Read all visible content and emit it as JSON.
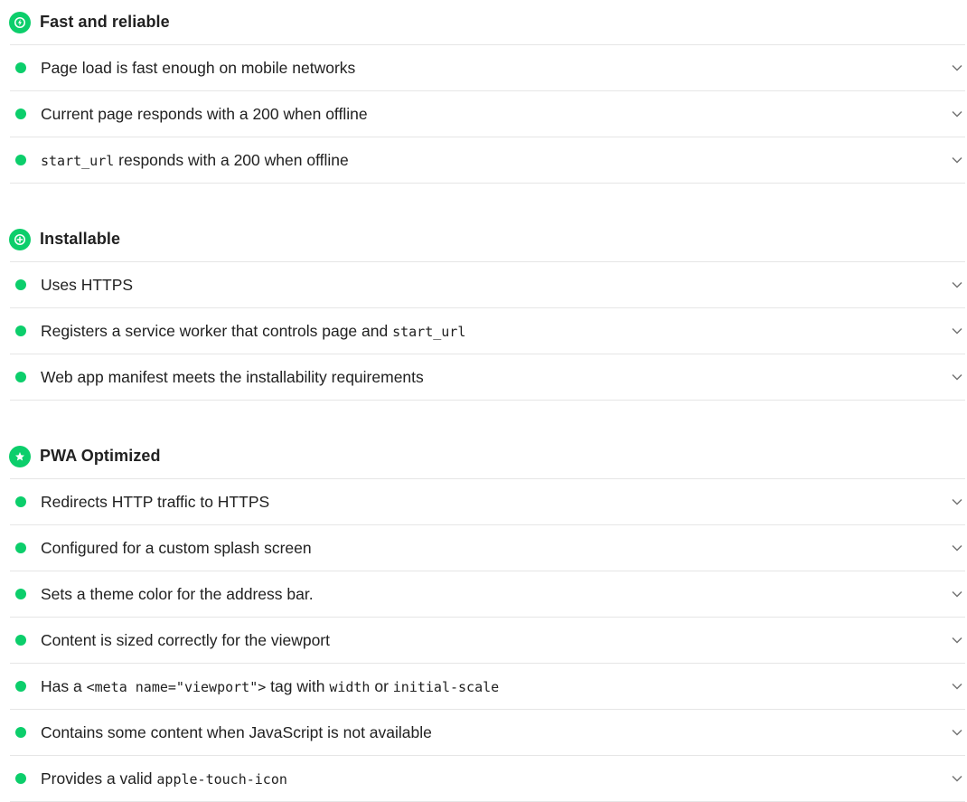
{
  "groups": [
    {
      "title": "Fast and reliable",
      "icon": "lightning-bolt-icon",
      "audits": [
        {
          "parts": [
            {
              "text": "Page load is fast enough on mobile networks"
            }
          ]
        },
        {
          "parts": [
            {
              "text": "Current page responds with a 200 when offline"
            }
          ]
        },
        {
          "parts": [
            {
              "code": "start_url"
            },
            {
              "text": " responds with a 200 when offline"
            }
          ]
        }
      ]
    },
    {
      "title": "Installable",
      "icon": "plus-icon",
      "audits": [
        {
          "parts": [
            {
              "text": "Uses HTTPS"
            }
          ]
        },
        {
          "parts": [
            {
              "text": "Registers a service worker that controls page and "
            },
            {
              "code": "start_url"
            }
          ]
        },
        {
          "parts": [
            {
              "text": "Web app manifest meets the installability requirements"
            }
          ]
        }
      ]
    },
    {
      "title": "PWA Optimized",
      "icon": "star-icon",
      "audits": [
        {
          "parts": [
            {
              "text": "Redirects HTTP traffic to HTTPS"
            }
          ]
        },
        {
          "parts": [
            {
              "text": "Configured for a custom splash screen"
            }
          ]
        },
        {
          "parts": [
            {
              "text": "Sets a theme color for the address bar."
            }
          ]
        },
        {
          "parts": [
            {
              "text": "Content is sized correctly for the viewport"
            }
          ]
        },
        {
          "parts": [
            {
              "text": "Has a "
            },
            {
              "code": "<meta name=\"viewport\">"
            },
            {
              "text": " tag with "
            },
            {
              "code": "width"
            },
            {
              "text": " or "
            },
            {
              "code": "initial-scale"
            }
          ]
        },
        {
          "parts": [
            {
              "text": "Contains some content when JavaScript is not available"
            }
          ]
        },
        {
          "parts": [
            {
              "text": "Provides a valid "
            },
            {
              "code": "apple-touch-icon"
            }
          ]
        }
      ]
    }
  ],
  "colors": {
    "pass": "#0cce6b",
    "text": "#212121",
    "divider": "#e6e6e6",
    "chevron": "#757575"
  }
}
